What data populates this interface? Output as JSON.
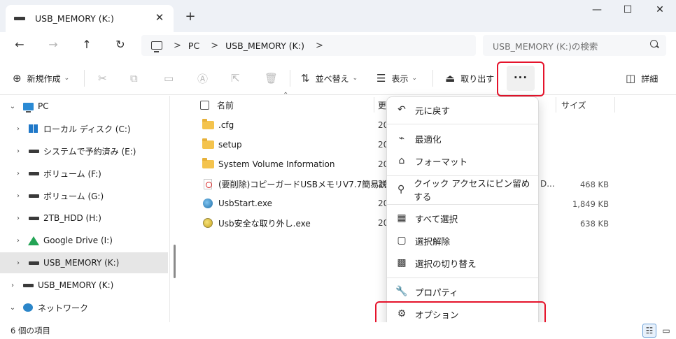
{
  "tab": {
    "title": "USB_MEMORY (K:)",
    "close_glyph": "✕",
    "new_tab_glyph": "+"
  },
  "window": {
    "minimize_glyph": "—",
    "maximize_glyph": "☐",
    "close_glyph": "✕"
  },
  "nav": {
    "back_glyph": "←",
    "forward_glyph": "→",
    "up_glyph": "↑",
    "refresh_glyph": "↻"
  },
  "address": {
    "crumbs": [
      "PC",
      "USB_MEMORY (K:)"
    ],
    "sep": ">"
  },
  "search": {
    "placeholder": "USB_MEMORY (K:)の検索"
  },
  "toolbar": {
    "new_label": "新規作成",
    "sort_label": "並べ替え",
    "view_label": "表示",
    "eject_label": "取り出す",
    "more_label": "···",
    "details_label": "詳細"
  },
  "sidebar": {
    "items": [
      {
        "label": "PC",
        "icon": "pc-icon",
        "expander": "⌄"
      },
      {
        "label": "ローカル ディスク (C:)",
        "icon": "local-disk-icon",
        "expander": "›"
      },
      {
        "label": "システムで予約済み (E:)",
        "icon": "drive-icon",
        "expander": "›"
      },
      {
        "label": "ボリューム (F:)",
        "icon": "drive-icon",
        "expander": "›"
      },
      {
        "label": "ボリューム (G:)",
        "icon": "drive-icon",
        "expander": "›"
      },
      {
        "label": "2TB_HDD (H:)",
        "icon": "drive-icon",
        "expander": "›"
      },
      {
        "label": "Google Drive (I:)",
        "icon": "google-drive-icon",
        "expander": "›"
      },
      {
        "label": "USB_MEMORY (K:)",
        "icon": "drive-icon",
        "expander": "›"
      },
      {
        "label": "USB_MEMORY (K:)",
        "icon": "drive-icon",
        "expander": "›"
      },
      {
        "label": "ネットワーク",
        "icon": "network-icon",
        "expander": "⌄"
      }
    ]
  },
  "list": {
    "columns": {
      "name": "名前",
      "date_partial": "更",
      "size": "サイズ"
    },
    "rows": [
      {
        "name": ".cfg",
        "date_partial": "20",
        "type_partial": "",
        "size": ""
      },
      {
        "name": "setup",
        "date_partial": "20",
        "type_partial": "",
        "size": ""
      },
      {
        "name": "System Volume Information",
        "date_partial": "20",
        "type_partial": "",
        "size": ""
      },
      {
        "name": "(要削除)コピーガードUSBメモリV7.7簡易説...",
        "date_partial": "20",
        "type_partial": "D...",
        "size": "468 KB"
      },
      {
        "name": "UsbStart.exe",
        "date_partial": "20",
        "type_partial": "",
        "size": "1,849 KB"
      },
      {
        "name": "Usb安全な取り外し.exe",
        "date_partial": "20",
        "type_partial": "",
        "size": "638 KB"
      }
    ]
  },
  "menu": {
    "items": [
      {
        "label": "元に戻す",
        "icon": "undo-icon",
        "glyph": "↶"
      },
      {
        "label": "最適化",
        "icon": "optimize-icon",
        "glyph": "⌁"
      },
      {
        "label": "フォーマット",
        "icon": "format-icon",
        "glyph": "⌂"
      },
      {
        "label": "クイック アクセスにピン留めする",
        "icon": "pin-icon",
        "glyph": "⚲"
      },
      {
        "label": "すべて選択",
        "icon": "select-all-icon",
        "glyph": "▦"
      },
      {
        "label": "選択解除",
        "icon": "select-none-icon",
        "glyph": "▢"
      },
      {
        "label": "選択の切り替え",
        "icon": "invert-selection-icon",
        "glyph": "▩"
      },
      {
        "label": "プロパティ",
        "icon": "wrench-icon",
        "glyph": "🔧"
      },
      {
        "label": "オプション",
        "icon": "gear-icon",
        "glyph": "⚙"
      }
    ]
  },
  "status": {
    "item_count": "6 個の項目"
  },
  "colors": {
    "highlight_red": "#e5132b",
    "selected_bg": "#e6e6e6",
    "accent_blue": "#1f6fc9"
  }
}
